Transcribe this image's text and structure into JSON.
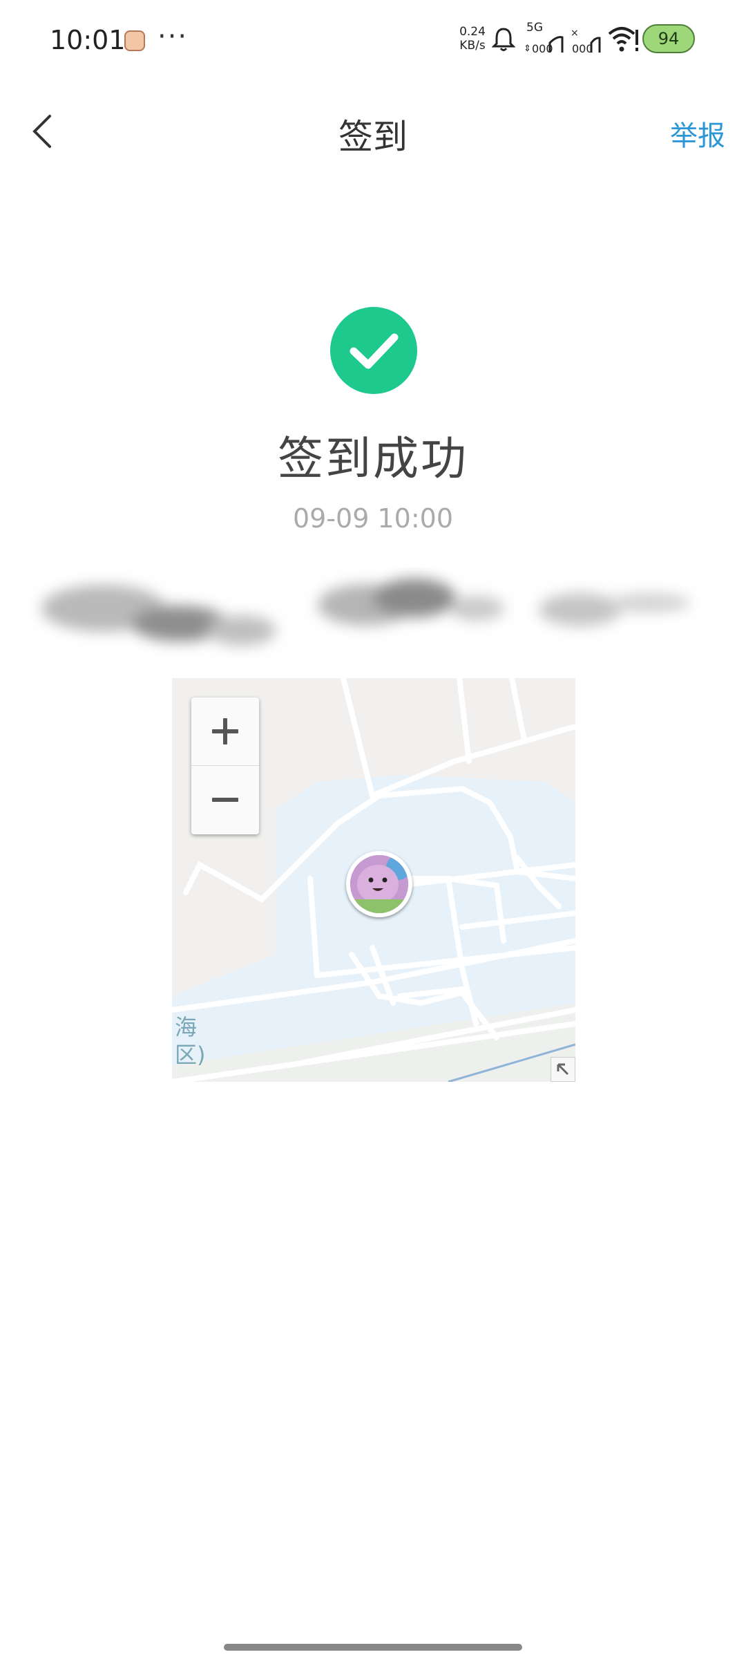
{
  "status_bar": {
    "time": "10:01",
    "more": "···",
    "net_speed_value": "0.24",
    "net_speed_unit": "KB/s",
    "network_type": "5G",
    "battery": "94",
    "icons": [
      "app-notification-icon",
      "bell-icon",
      "signal-5g-icon",
      "signal-sim2-icon",
      "wifi-icon",
      "battery-icon"
    ]
  },
  "nav": {
    "back_icon": "chevron-left-icon",
    "title": "签到",
    "report": "举报"
  },
  "result": {
    "icon": "check-circle-icon",
    "title": "签到成功",
    "time": "09-09 10:00"
  },
  "map": {
    "zoom_in": "zoom-in",
    "zoom_out": "zoom-out",
    "label_line1": "海",
    "label_line2": "区)"
  },
  "colors": {
    "accent_blue": "#2c97d6",
    "success_green": "#1dc98c",
    "map_water": "#e6f1fa",
    "map_land": "#f1f0ee"
  }
}
